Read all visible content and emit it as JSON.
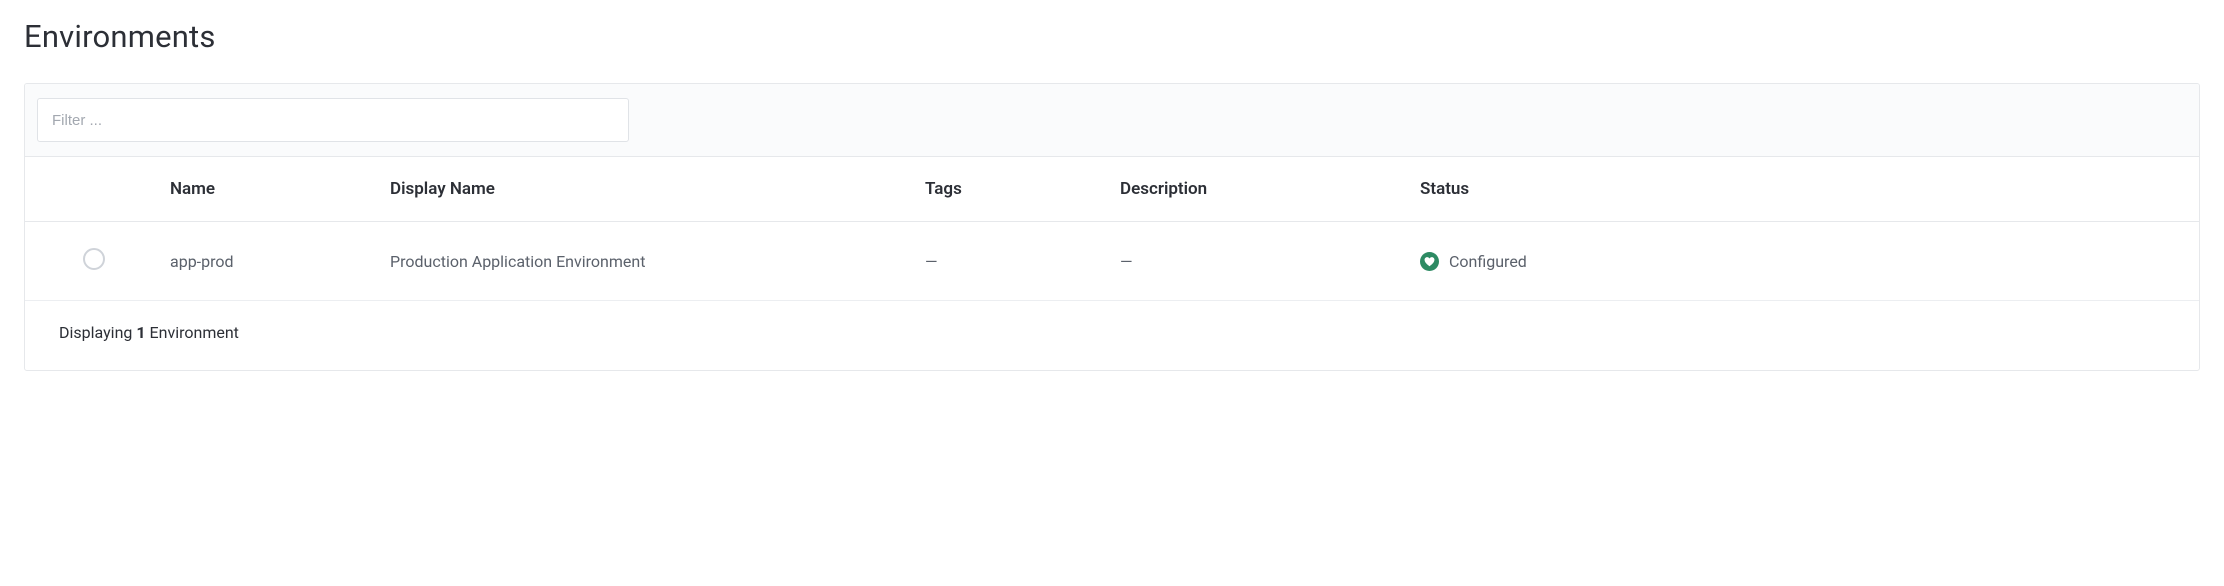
{
  "page": {
    "title": "Environments"
  },
  "filter": {
    "placeholder": "Filter ..."
  },
  "table": {
    "headers": {
      "name": "Name",
      "display_name": "Display Name",
      "tags": "Tags",
      "description": "Description",
      "status": "Status"
    },
    "rows": [
      {
        "name": "app-prod",
        "display_name": "Production Application Environment",
        "tags": "—",
        "description": "—",
        "status": "Configured",
        "status_color": "#2d8a63"
      }
    ]
  },
  "footer": {
    "prefix": "Displaying ",
    "count": "1",
    "suffix": " Environment"
  }
}
